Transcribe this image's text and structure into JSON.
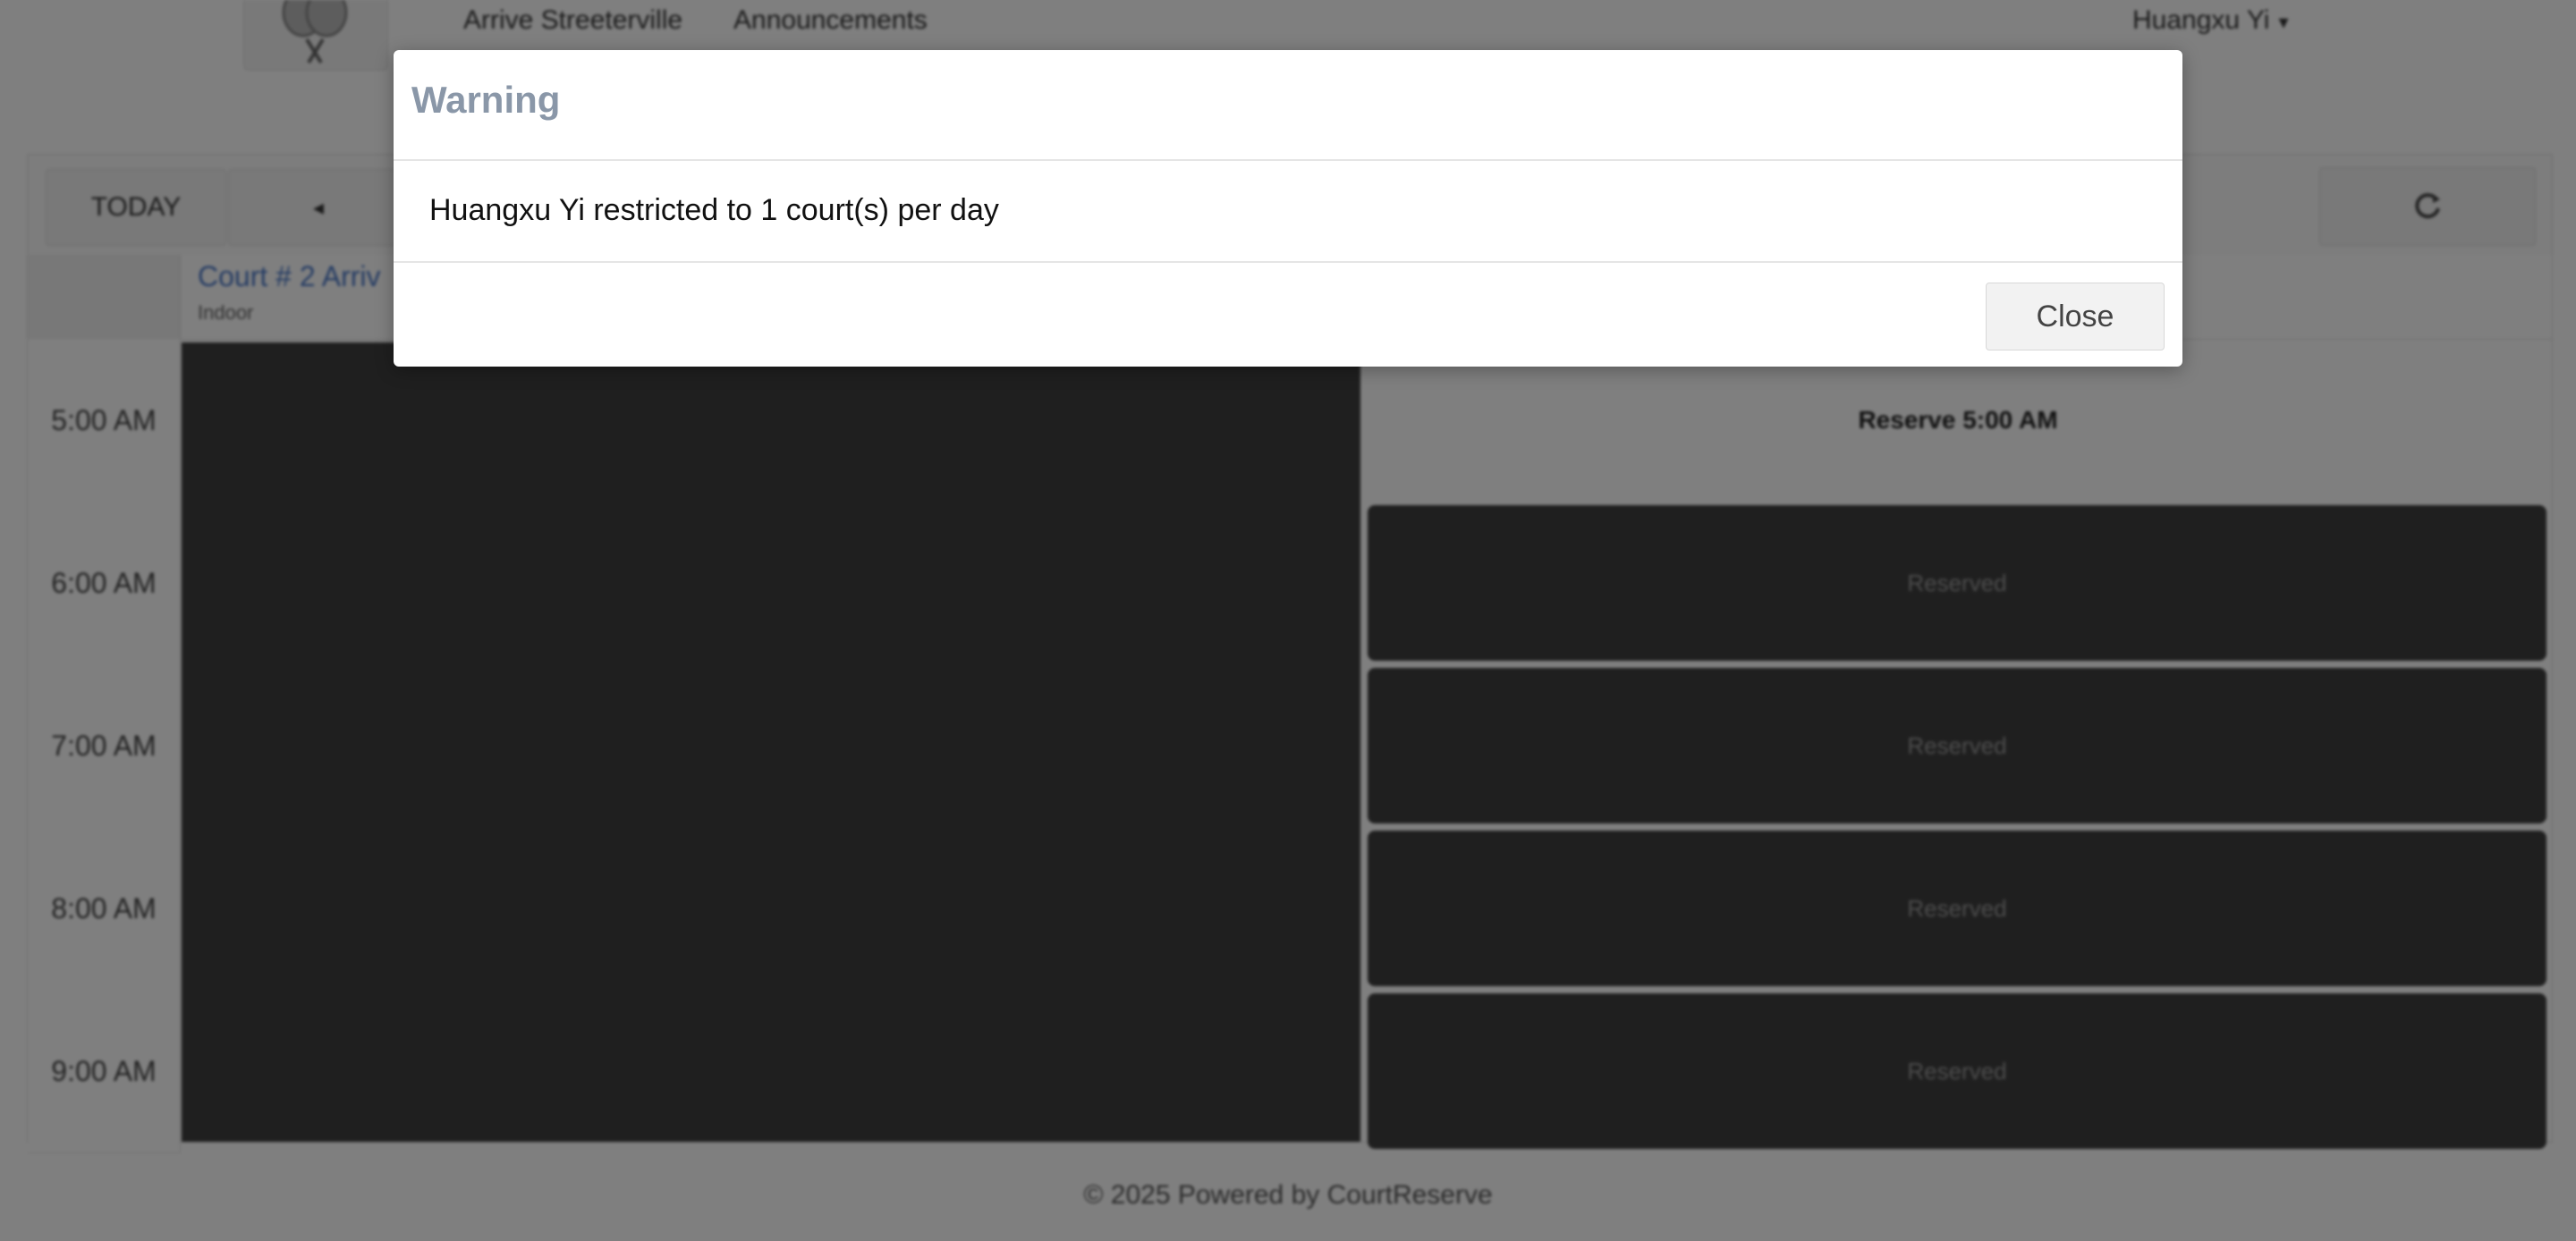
{
  "header": {
    "nav": [
      "Arrive Streeterville",
      "Announcements"
    ],
    "user_name": "Huangxu Yi",
    "user_caret": "▾"
  },
  "scheduler": {
    "today_label": "TODAY",
    "prev_icon": "◂",
    "refresh_icon": "refresh-icon",
    "court": {
      "title": "Court # 2 Arriv",
      "subtitle": "Indoor"
    },
    "times": [
      "5:00 AM",
      "6:00 AM",
      "7:00 AM",
      "8:00 AM",
      "9:00 AM"
    ],
    "reserve_label": "Reserve 5:00 AM",
    "reserved_label": "Reserved"
  },
  "footer": {
    "text": "© 2025 Powered by CourtReserve"
  },
  "modal": {
    "title": "Warning",
    "message": "Huangxu Yi restricted to 1 court(s) per day",
    "close_label": "Close"
  }
}
